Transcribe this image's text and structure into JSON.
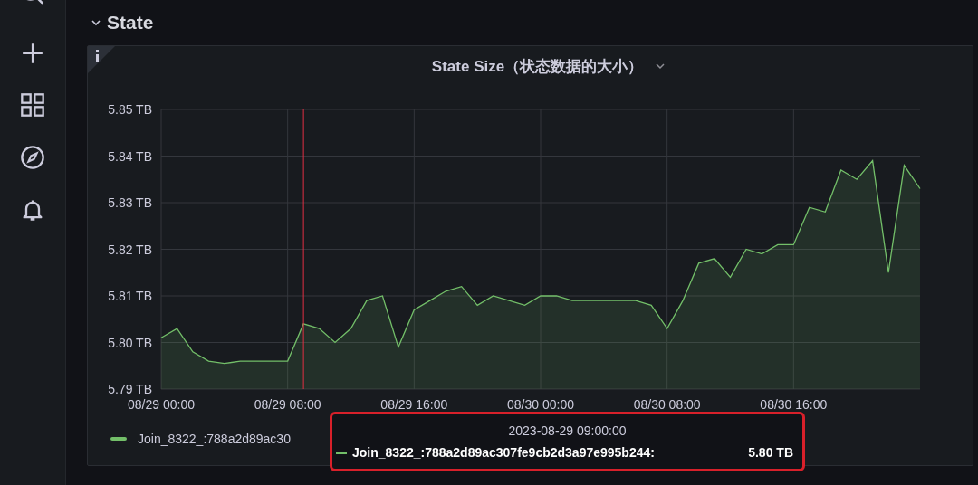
{
  "sidebar": {
    "items": [
      {
        "kind": "search"
      },
      {
        "kind": "plus"
      },
      {
        "kind": "grid"
      },
      {
        "kind": "compass"
      },
      {
        "kind": "bell"
      }
    ]
  },
  "row": {
    "title": "State",
    "expanded": true
  },
  "panel": {
    "title": "State Size（状态数据的大小）",
    "info": true,
    "chart_data": {
      "type": "area",
      "ylim": [
        5.79,
        5.85
      ],
      "categories": [
        "08/29 00:00",
        null,
        null,
        null,
        null,
        null,
        null,
        null,
        "08/29 08:00",
        null,
        null,
        null,
        null,
        null,
        null,
        null,
        "08/29 16:00",
        null,
        null,
        null,
        null,
        null,
        null,
        null,
        "08/30 00:00",
        null,
        null,
        null,
        null,
        null,
        null,
        null,
        "08/30 08:00",
        null,
        null,
        null,
        null,
        null,
        null,
        null,
        "08/30 16:00",
        null,
        null,
        null,
        null,
        null,
        null,
        null,
        null
      ],
      "yticks": [
        {
          "value": 5.79,
          "label": "5.79 TB"
        },
        {
          "value": 5.8,
          "label": "5.80 TB"
        },
        {
          "value": 5.81,
          "label": "5.81 TB"
        },
        {
          "value": 5.82,
          "label": "5.82 TB"
        },
        {
          "value": 5.83,
          "label": "5.83 TB"
        },
        {
          "value": 5.84,
          "label": "5.84 TB"
        },
        {
          "value": 5.85,
          "label": "5.85 TB"
        }
      ],
      "series": [
        {
          "name": "Join_8322_:788a2d89ac30",
          "color": "#73bf69",
          "values": [
            5.801,
            5.803,
            5.798,
            5.796,
            5.7955,
            5.796,
            5.796,
            5.796,
            5.796,
            5.804,
            5.803,
            5.8,
            5.803,
            5.809,
            5.81,
            5.799,
            5.807,
            5.809,
            5.811,
            5.812,
            5.808,
            5.81,
            5.809,
            5.808,
            5.81,
            5.81,
            5.809,
            5.809,
            5.809,
            5.809,
            5.809,
            5.808,
            5.803,
            5.809,
            5.817,
            5.818,
            5.814,
            5.82,
            5.819,
            5.821,
            5.821,
            5.829,
            5.828,
            5.837,
            5.835,
            5.839,
            5.815,
            5.838,
            5.833
          ]
        }
      ],
      "grid": true
    },
    "tooltip": {
      "time": "2023-08-29 09:00:00",
      "series": [
        {
          "label": "Join_8322_:788a2d89ac307fe9cb2d3a97e995b244:",
          "value": "5.80 TB",
          "color": "#73bf69"
        }
      ]
    }
  }
}
